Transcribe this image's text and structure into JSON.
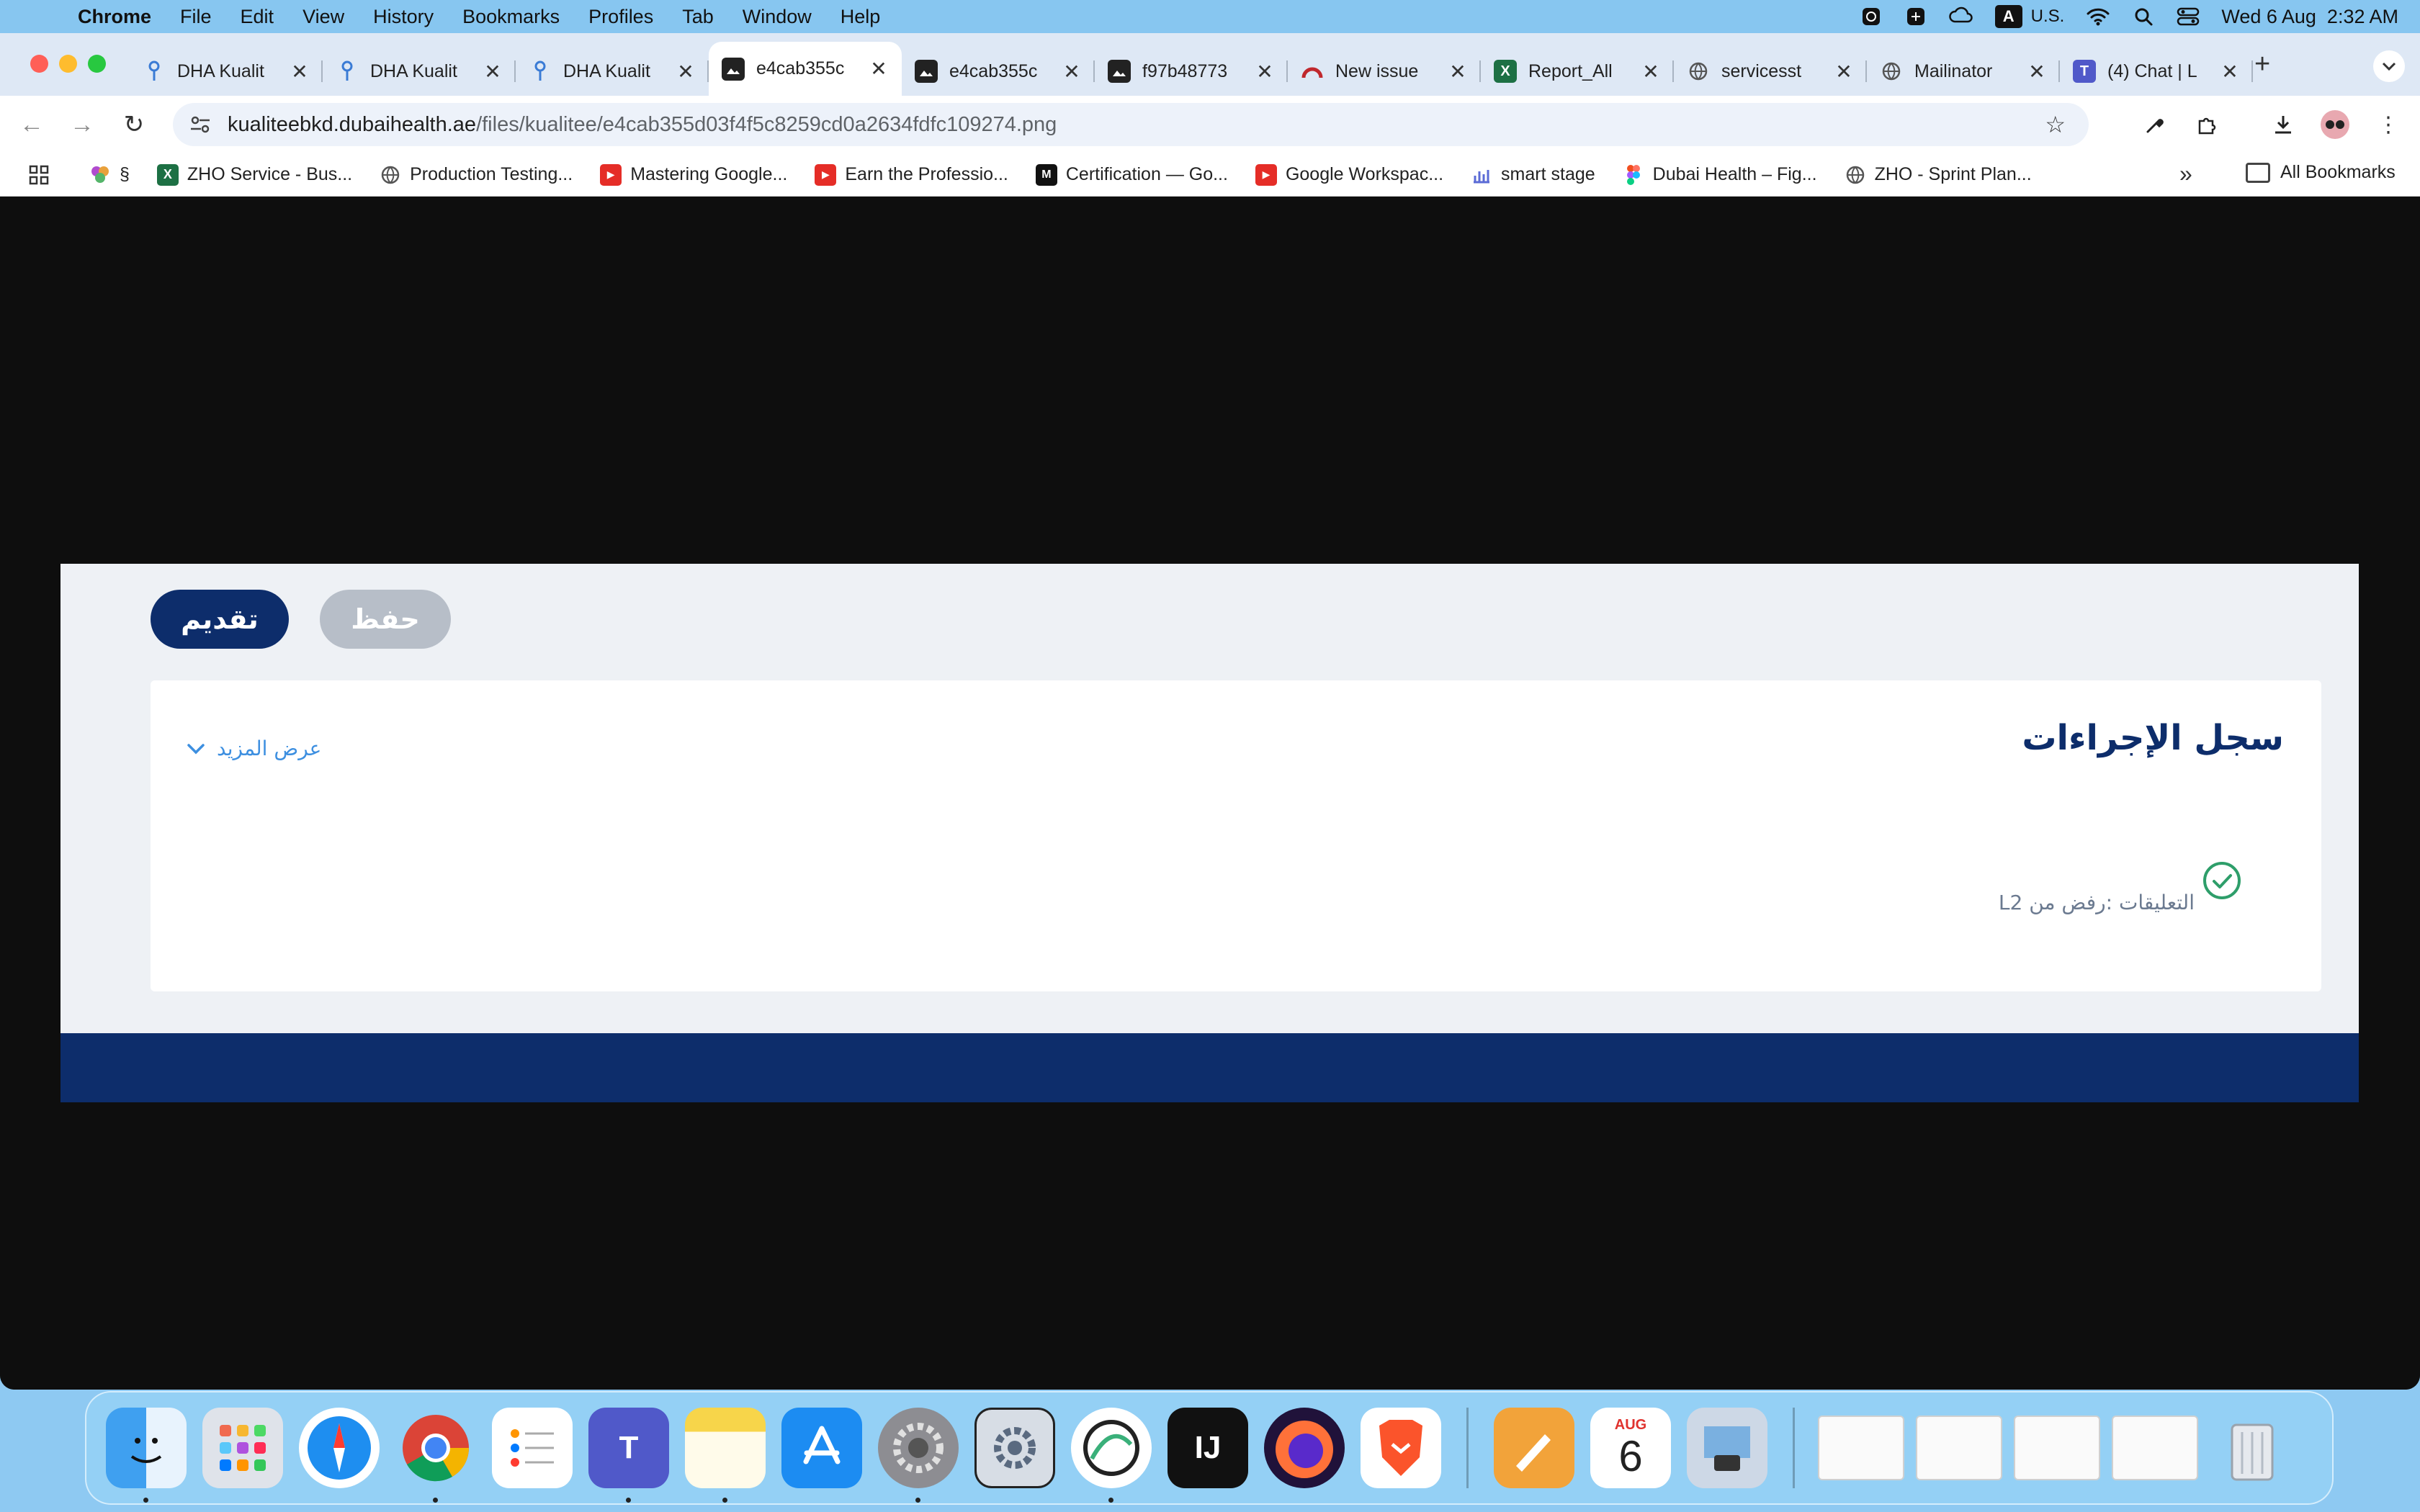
{
  "menubar": {
    "app_name": "Chrome",
    "menus": [
      "File",
      "Edit",
      "View",
      "History",
      "Bookmarks",
      "Profiles",
      "Tab",
      "Window",
      "Help"
    ],
    "input_source": "U.S.",
    "input_badge": "A",
    "datetime": "Wed 6 Aug  2:32 AM"
  },
  "tabs": [
    {
      "title": "DHA Kualit",
      "icon": "key-icon",
      "active": false
    },
    {
      "title": "DHA Kualit",
      "icon": "key-icon",
      "active": false
    },
    {
      "title": "DHA Kualit",
      "icon": "key-icon",
      "active": false
    },
    {
      "title": "e4cab355c",
      "icon": "image-file-icon",
      "active": true
    },
    {
      "title": "e4cab355c",
      "icon": "image-file-icon",
      "active": false
    },
    {
      "title": "f97b48773",
      "icon": "image-file-icon",
      "active": false
    },
    {
      "title": "New issue",
      "icon": "redmine-icon",
      "active": false
    },
    {
      "title": "Report_All",
      "icon": "excel-icon",
      "active": false
    },
    {
      "title": "servicesst",
      "icon": "globe-icon",
      "active": false
    },
    {
      "title": "Mailinator",
      "icon": "globe-icon",
      "active": false
    },
    {
      "title": "(4) Chat | L",
      "icon": "teams-icon",
      "active": false
    }
  ],
  "toolbar": {
    "url_host": "kualiteebkd.dubaihealth.ae",
    "url_path": "/files/kualitee/e4cab355d03f4f5c8259cd0a2634fdfc109274.png"
  },
  "bookmarks": [
    {
      "label": "§",
      "icon": "flower-icon"
    },
    {
      "label": "ZHO Service - Bus...",
      "icon": "excel-icon"
    },
    {
      "label": "Production Testing...",
      "icon": "globe-icon"
    },
    {
      "label": "Mastering Google...",
      "icon": "youtube-icon"
    },
    {
      "label": "Earn the Professio...",
      "icon": "youtube-icon"
    },
    {
      "label": "Certification — Go...",
      "icon": "medium-icon"
    },
    {
      "label": "Google Workspac...",
      "icon": "youtube-icon"
    },
    {
      "label": "smart stage",
      "icon": "chart-icon"
    },
    {
      "label": "Dubai Health – Fig...",
      "icon": "figma-icon"
    },
    {
      "label": "ZHO - Sprint Plan...",
      "icon": "globe-icon"
    }
  ],
  "bookmarks_all": "All Bookmarks",
  "page": {
    "submit_button": "تقديم",
    "save_button": "حفظ",
    "card_title": "سجل الإجراءات",
    "show_more": "عرض المزيد",
    "comment": "التعليقات :رفض من L2"
  },
  "dock": {
    "calendar_month": "AUG",
    "calendar_day": "6"
  },
  "colors": {
    "primary_navy": "#0d2d6b",
    "disabled_gray": "#b7bec8",
    "link_blue": "#3d8fe0",
    "success_green": "#2e9e6a"
  }
}
